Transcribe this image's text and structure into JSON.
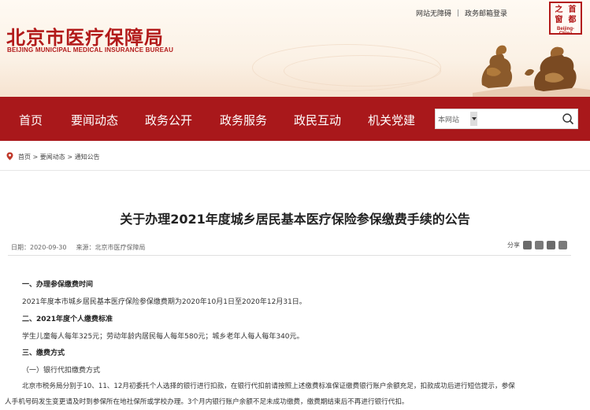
{
  "header": {
    "logo_cn": "北京市医疗保障局",
    "logo_en": "BEIJING MUNICIPAL MEDICAL INSURANCE BUREAU",
    "top_links": [
      "网站无障碍",
      "政务邮箱登录"
    ],
    "seal_chars": [
      "之",
      "首",
      "窗",
      "都"
    ],
    "seal_en": "Beijing-China"
  },
  "nav": {
    "items": [
      "首页",
      "要闻动态",
      "政务公开",
      "政务服务",
      "政民互动",
      "机关党建"
    ],
    "search_scope": "本网站",
    "search_placeholder": ""
  },
  "breadcrumb": "首页 > 要闻动态 > 通知公告",
  "article": {
    "title": "关于办理2021年度城乡居民基本医疗保险参保缴费手续的公告",
    "date": "日期：2020-09-30",
    "source": "来源：北京市医疗保障局",
    "share_label": "分享",
    "paragraphs": [
      "一、办理参保缴费时间",
      "2021年度本市城乡居民基本医疗保险参保缴费期为2020年10月1日至2020年12月31日。",
      "二、2021年度个人缴费标准",
      "学生儿童每人每年325元；劳动年龄内居民每人每年580元；城乡老年人每人每年340元。",
      "三、缴费方式",
      "（一）银行代扣缴费方式",
      "北京市税务局分别于10、11、12月初委托个人选择的银行进行扣款，在银行代扣前请按照上述缴费标准保证缴费银行账户余额充足，扣款成功后进行短信提示，参保",
      "人手机号码发生变更请及时到参保所在地社保所或学校办理。3个月内银行账户余额不足未成功缴费，缴费期结束后不再进行银行代扣。"
    ]
  },
  "colors": {
    "brand_red": "#a9181b",
    "logo_red": "#b21a1a"
  }
}
